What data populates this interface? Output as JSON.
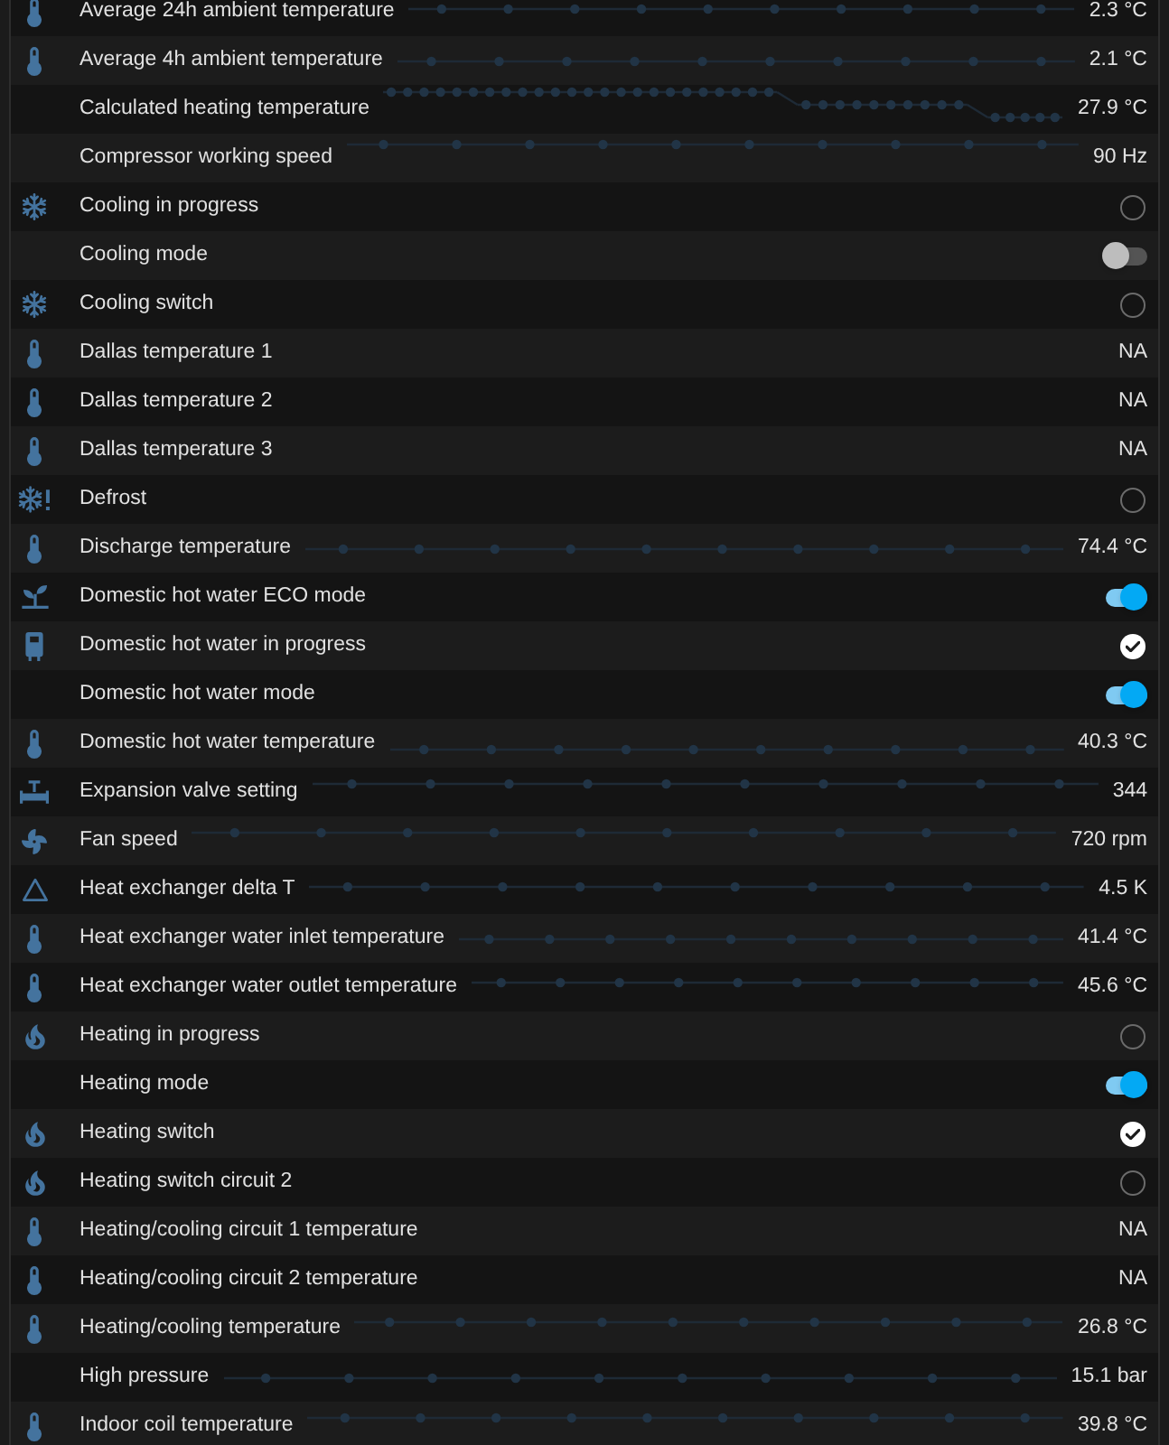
{
  "rows": [
    {
      "kind": "value",
      "name": "Average 24h ambient temperature",
      "value": "2.3 °C"
    },
    {
      "kind": "value",
      "name": "Average 4h ambient temperature",
      "value": "2.1 °C"
    },
    {
      "kind": "value",
      "name": "Calculated heating temperature",
      "value": "27.9 °C"
    },
    {
      "kind": "value",
      "name": "Compressor working speed",
      "value": "90 Hz"
    },
    {
      "kind": "check",
      "name": "Cooling in progress",
      "checked": false
    },
    {
      "kind": "toggle",
      "name": "Cooling mode",
      "on": false
    },
    {
      "kind": "check",
      "name": "Cooling switch",
      "checked": false
    },
    {
      "kind": "value",
      "name": "Dallas temperature 1",
      "value": "NA"
    },
    {
      "kind": "value",
      "name": "Dallas temperature 2",
      "value": "NA"
    },
    {
      "kind": "value",
      "name": "Dallas temperature 3",
      "value": "NA"
    },
    {
      "kind": "check",
      "name": "Defrost",
      "checked": false
    },
    {
      "kind": "value",
      "name": "Discharge temperature",
      "value": "74.4 °C"
    },
    {
      "kind": "toggle",
      "name": "Domestic hot water ECO mode",
      "on": true
    },
    {
      "kind": "check",
      "name": "Domestic hot water in progress",
      "checked": true
    },
    {
      "kind": "toggle",
      "name": "Domestic hot water mode",
      "on": true
    },
    {
      "kind": "value",
      "name": "Domestic hot water temperature",
      "value": "40.3 °C"
    },
    {
      "kind": "value",
      "name": "Expansion valve setting",
      "value": "344"
    },
    {
      "kind": "value",
      "name": "Fan speed",
      "value": "720 rpm"
    },
    {
      "kind": "value",
      "name": "Heat exchanger delta T",
      "value": "4.5 K"
    },
    {
      "kind": "value",
      "name": "Heat exchanger water inlet temperature",
      "value": "41.4 °C"
    },
    {
      "kind": "value",
      "name": "Heat exchanger water outlet temperature",
      "value": "45.6 °C"
    },
    {
      "kind": "check",
      "name": "Heating in progress",
      "checked": false
    },
    {
      "kind": "toggle",
      "name": "Heating mode",
      "on": true
    },
    {
      "kind": "check",
      "name": "Heating switch",
      "checked": true
    },
    {
      "kind": "check",
      "name": "Heating switch circuit 2",
      "checked": false
    },
    {
      "kind": "value",
      "name": "Heating/cooling circuit 1 temperature",
      "value": "NA"
    },
    {
      "kind": "value",
      "name": "Heating/cooling circuit 2 temperature",
      "value": "NA"
    },
    {
      "kind": "value",
      "name": "Heating/cooling temperature",
      "value": "26.8 °C"
    },
    {
      "kind": "value",
      "name": "High pressure",
      "value": "15.1 bar"
    },
    {
      "kind": "value",
      "name": "Indoor coil temperature",
      "value": "39.8 °C"
    }
  ]
}
